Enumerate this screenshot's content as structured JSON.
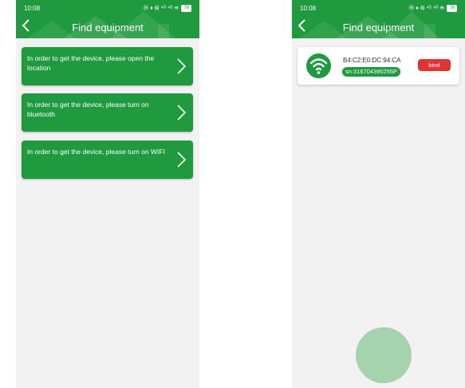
{
  "status_bar": {
    "time": "10:08",
    "battery": "78",
    "network": "Ⓜ ♦ ⊞ ⁴ᴳ ⁴ᴳ ≋"
  },
  "left": {
    "title": "Find equipment",
    "cards": [
      {
        "text": "In order to get the device, please open the location"
      },
      {
        "text": "In order to get the device, please turn on bluetooth"
      },
      {
        "text": "In order to get the device, please turn on WIFI"
      }
    ]
  },
  "right": {
    "title": "Find equipment",
    "device": {
      "mac": "B4:C2:E0:DC:94:CA",
      "sn": "sn:316704390255P",
      "bind_label": "bind"
    }
  },
  "colors": {
    "brand_green": "#1f9a3e",
    "bind_red": "#e23333",
    "fab_green": "#a5d3ae"
  },
  "icons": [
    "back-arrow-icon",
    "chevron-right-icon",
    "wifi-icon"
  ]
}
